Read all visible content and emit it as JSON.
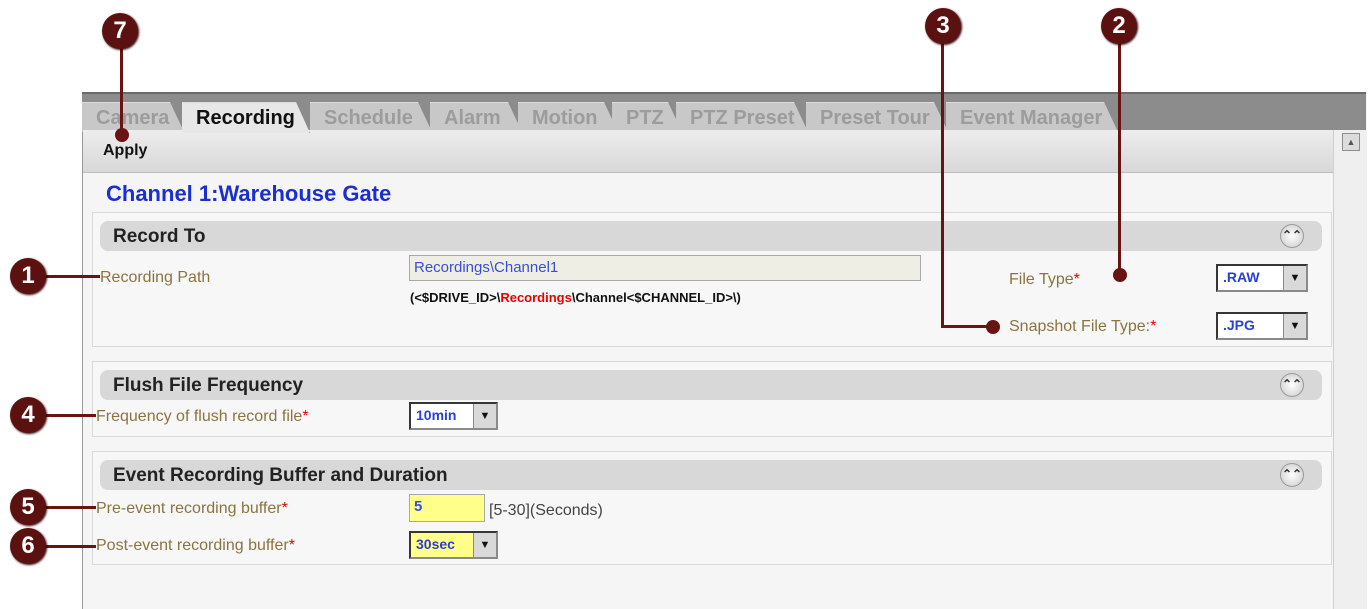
{
  "tabs": [
    "Camera",
    "Recording",
    "Schedule",
    "Alarm",
    "Motion",
    "PTZ",
    "PTZ Preset",
    "Preset Tour",
    "Event Manager"
  ],
  "toolbar": {
    "apply_label": "Apply"
  },
  "channel_title": "Channel 1:Warehouse Gate",
  "record_to": {
    "title": "Record To",
    "recording_path_label": "Recording Path",
    "recording_path_value": "Recordings\\Channel1",
    "path_hint_prefix": "(<$DRIVE_ID>\\",
    "path_hint_highlight": "Recordings",
    "path_hint_suffix": "\\Channel<$CHANNEL_ID>\\)",
    "file_type_label": "File Type",
    "file_type_value": ".RAW",
    "snapshot_type_label": "Snapshot File Type:",
    "snapshot_type_value": ".JPG"
  },
  "flush": {
    "title": "Flush File Frequency",
    "frequency_label": "Frequency of flush record file",
    "frequency_value": "10min"
  },
  "event_buffer": {
    "title": "Event Recording Buffer and Duration",
    "pre_label": "Pre-event recording buffer",
    "pre_value": "5",
    "pre_range": "[5-30](Seconds)",
    "post_label": "Post-event recording buffer",
    "post_value": "30sec"
  },
  "required_mark": "*",
  "callouts": {
    "c1": "1",
    "c2": "2",
    "c3": "3",
    "c4": "4",
    "c5": "5",
    "c6": "6",
    "c7": "7"
  },
  "icons": {
    "collapse": "double-chevron-up-icon",
    "dropdown": "triangle-down-icon",
    "scroll_up": "triangle-up-icon"
  },
  "colors": {
    "callout": "#5c1111",
    "label": "#8a7440",
    "channel_title": "#1a2fd0",
    "required": "#e00000",
    "highlight_field": "#ffff8a"
  }
}
